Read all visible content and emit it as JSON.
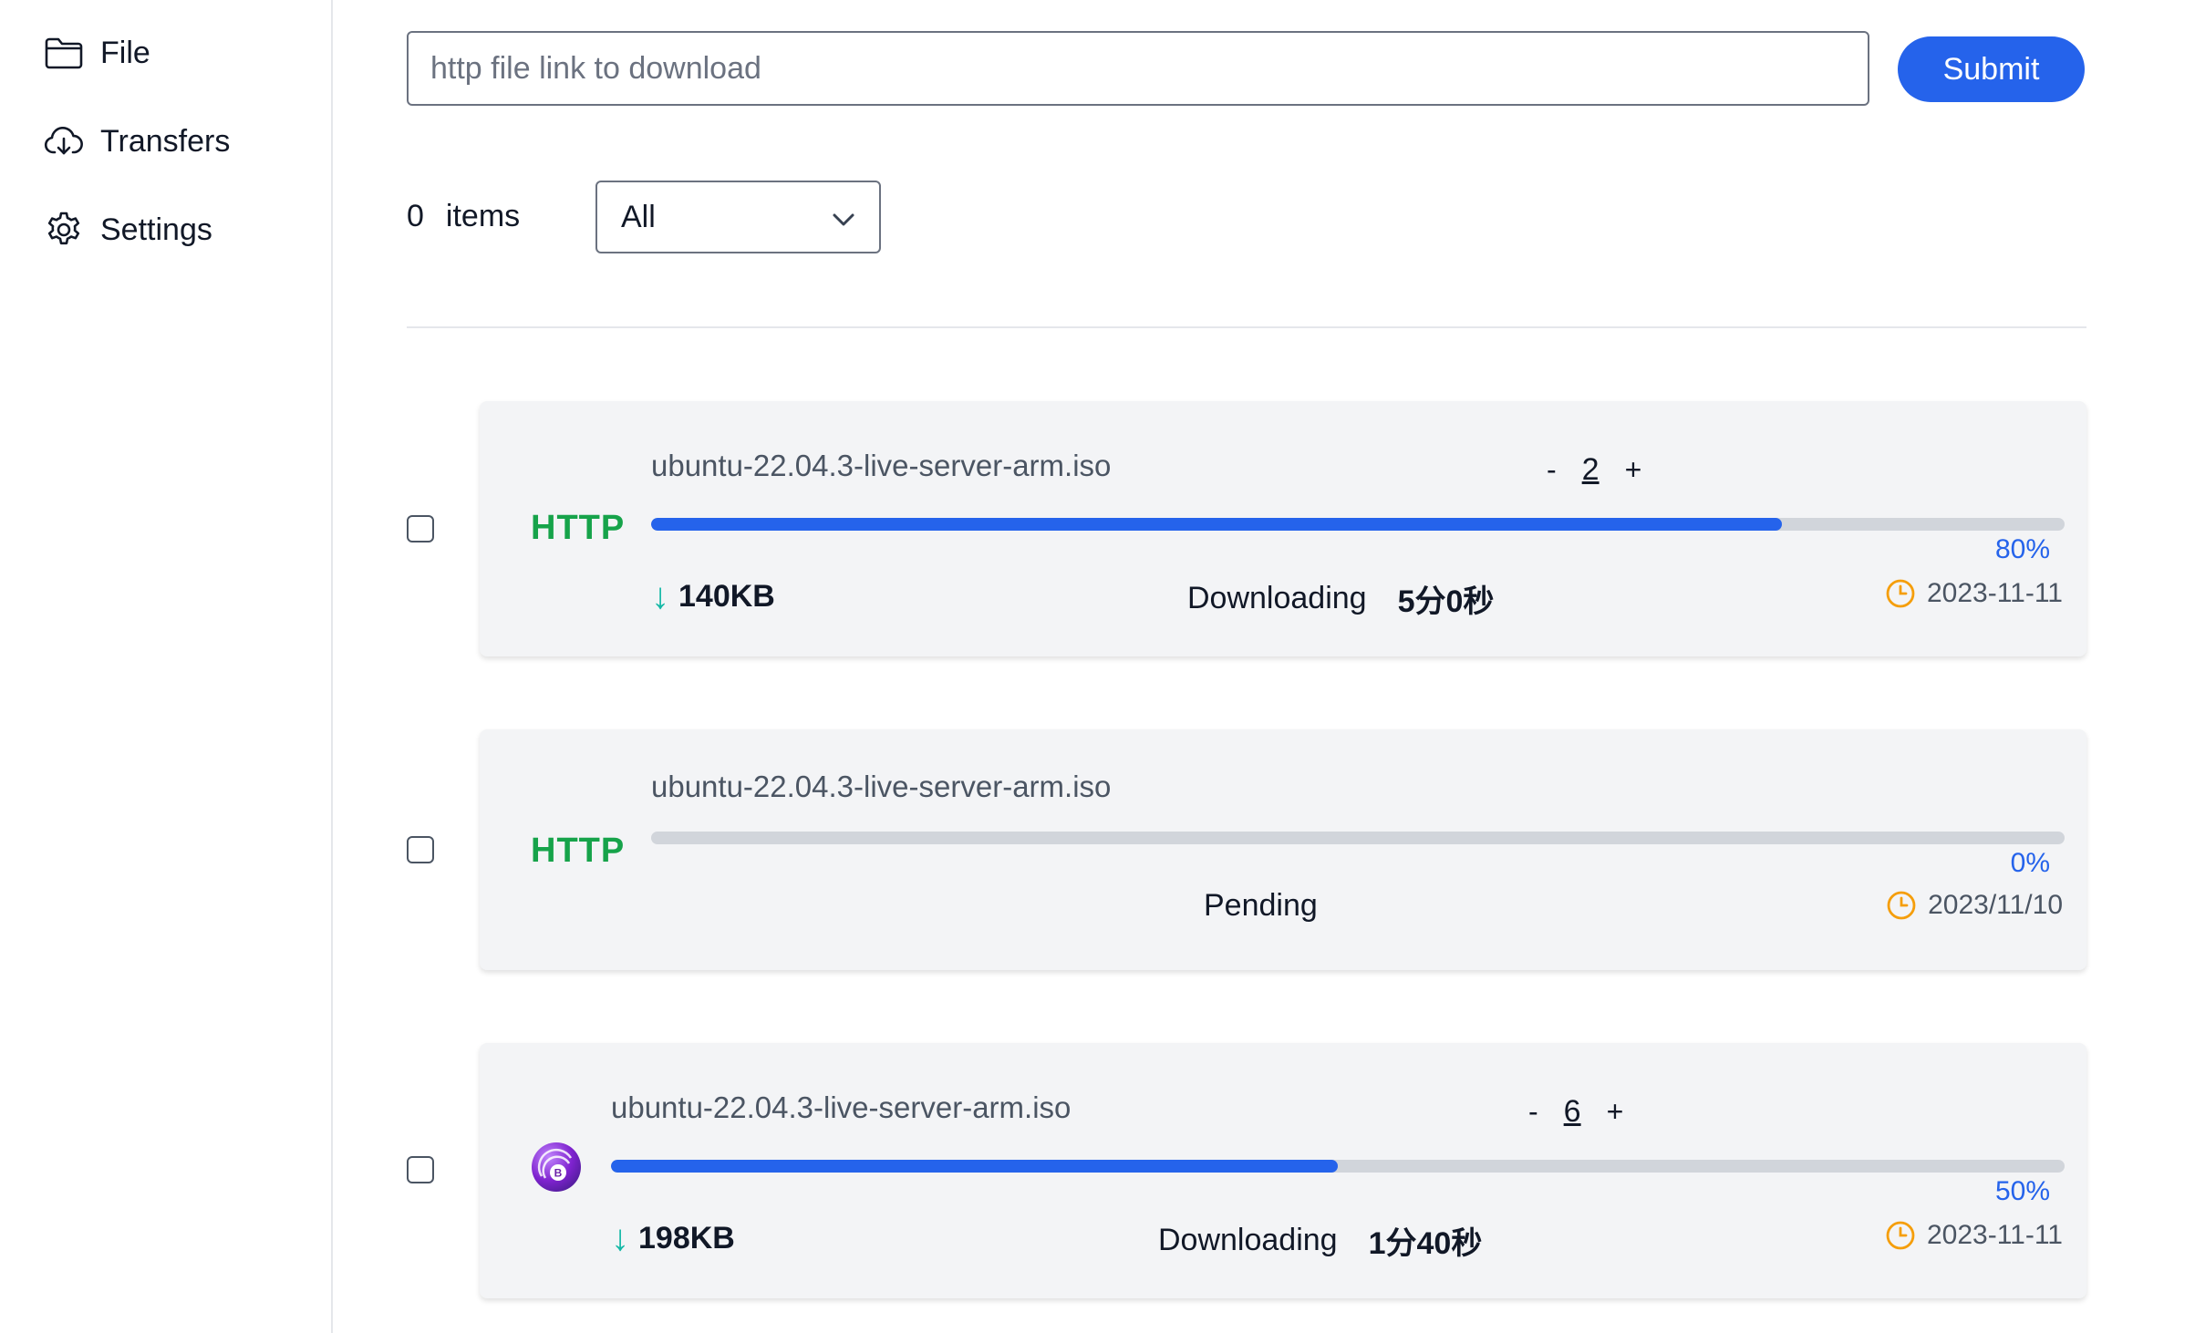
{
  "sidebar": {
    "items": [
      {
        "label": "File",
        "icon": "folder-icon"
      },
      {
        "label": "Transfers",
        "icon": "cloud-download-icon"
      },
      {
        "label": "Settings",
        "icon": "gear-icon"
      }
    ]
  },
  "toolbar": {
    "url_placeholder": "http file link to download",
    "url_value": "",
    "submit_label": "Submit",
    "submit_color": "#2563eb"
  },
  "list_header": {
    "count": "0",
    "count_label": "items",
    "filter_selected": "All"
  },
  "transfers": [
    {
      "protocol": "HTTP",
      "filename": "ubuntu-22.04.3-live-server-arm.iso",
      "threads": "2",
      "progress": 0.8,
      "progress_label": "80%",
      "speed": "140KB",
      "status": "Downloading",
      "eta": "5分0秒",
      "date": "2023-11-11",
      "checked": false
    },
    {
      "protocol": "HTTP",
      "filename": "ubuntu-22.04.3-live-server-arm.iso",
      "progress": 0.0,
      "progress_label": "0%",
      "status": "Pending",
      "date": "2023/11/10",
      "checked": false
    },
    {
      "protocol_icon": "bittorrent-icon",
      "filename": "ubuntu-22.04.3-live-server-arm.iso",
      "threads": "6",
      "progress": 0.5,
      "progress_label": "50%",
      "speed": "198KB",
      "status": "Downloading",
      "eta": "1分40秒",
      "date": "2023-11-11",
      "checked": false
    }
  ],
  "stepper_labels": {
    "minus": "-",
    "plus": "+"
  },
  "colors": {
    "accent": "#2563eb",
    "protocol": "#16a34a",
    "speed_arrow": "#14b8a6",
    "clock": "#f59e0b"
  }
}
